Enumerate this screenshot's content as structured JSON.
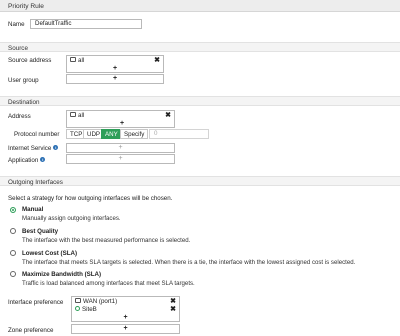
{
  "title": "Priority Rule",
  "name": {
    "label": "Name",
    "value": "DefaultTraffic"
  },
  "source": {
    "heading": "Source",
    "address_label": "Source address",
    "address_entries": [
      {
        "icon": "address-icon",
        "label": "all"
      }
    ],
    "user_group_label": "User group",
    "add_symbol": "+",
    "remove_symbol": "✖"
  },
  "destination": {
    "heading": "Destination",
    "address_label": "Address",
    "address_entries": [
      {
        "icon": "address-icon",
        "label": "all"
      }
    ],
    "protocol_label": "Protocol number",
    "protocol_options": [
      "TCP",
      "UDP",
      "ANY",
      "Specify"
    ],
    "protocol_selected": "ANY",
    "protocol_value": "0",
    "internet_service_label": "Internet Service",
    "application_label": "Application"
  },
  "outgoing": {
    "heading": "Outgoing Interfaces",
    "prompt": "Select a strategy for how outgoing interfaces will be chosen.",
    "strategies": [
      {
        "title": "Manual",
        "desc": "Manually assign outgoing interfaces.",
        "selected": true
      },
      {
        "title": "Best Quality",
        "desc": "The interface with the best measured performance is selected.",
        "selected": false
      },
      {
        "title": "Lowest Cost (SLA)",
        "desc": "The interface that meets SLA targets is selected. When there is a tie, the interface with the lowest assigned cost is selected.",
        "selected": false
      },
      {
        "title": "Maximize Bandwidth (SLA)",
        "desc": "Traffic is load balanced among interfaces that meet SLA targets.",
        "selected": false
      }
    ],
    "interface_pref_label": "Interface preference",
    "interface_entries": [
      {
        "icon": "port-icon",
        "label": "WAN (port1)"
      },
      {
        "icon": "vpn-icon",
        "label": "SiteB"
      }
    ],
    "zone_pref_label": "Zone preference"
  },
  "colors": {
    "accent": "#2e9f59",
    "info": "#2b6fb4"
  }
}
